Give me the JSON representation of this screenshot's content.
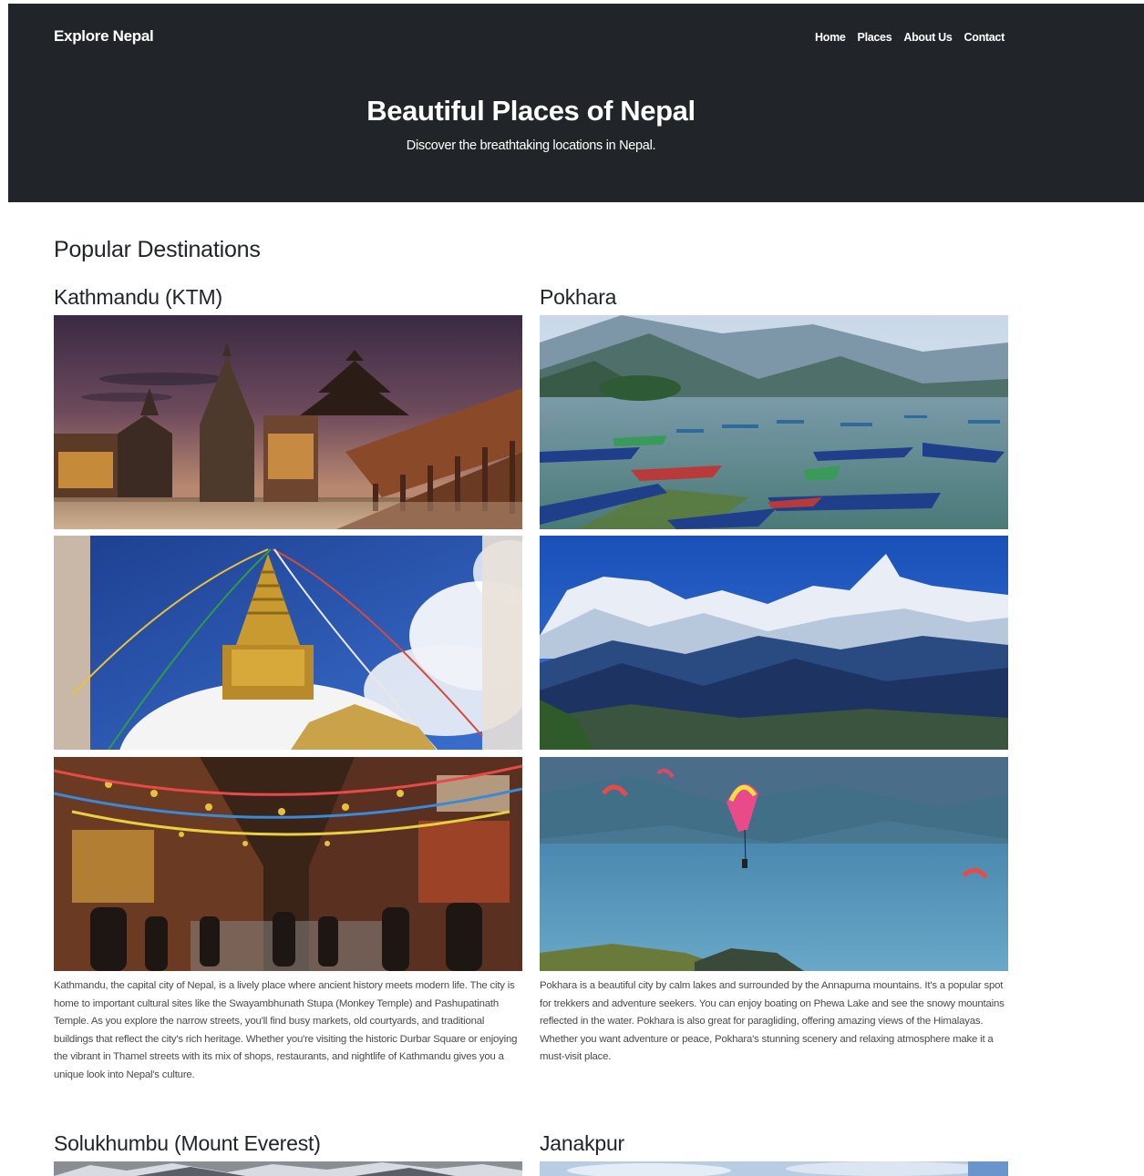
{
  "header": {
    "brand": "Explore Nepal",
    "nav": [
      "Home",
      "Places",
      "About Us",
      "Contact"
    ],
    "title": "Beautiful Places of Nepal",
    "subtitle": "Discover the breathtaking locations in Nepal."
  },
  "main": {
    "section_title": "Popular Destinations",
    "places": [
      {
        "name": "Kathmandu (KTM)",
        "description": "Kathmandu, the capital city of Nepal, is a lively place where ancient history meets modern life. The city is home to important cultural sites like the Swayambhunath Stupa (Monkey Temple) and Pashupatinath Temple. As you explore the narrow streets, you'll find busy markets, old courtyards, and traditional buildings that reflect the city's rich heritage. Whether you're visiting the historic Durbar Square or enjoying the vibrant in Thamel streets with its mix of shops, restaurants, and nightlife of Kathmandu gives you a unique look into Nepal's culture.",
        "photos": [
          "durbar-square-dusk",
          "swayambhunath-stupa",
          "thamel-street"
        ]
      },
      {
        "name": "Pokhara",
        "description": "Pokhara is a beautiful city by calm lakes and surrounded by the Annapurna mountains. It's a popular spot for trekkers and adventure seekers. You can enjoy boating on Phewa Lake and see the snowy mountains reflected in the water. Pokhara is also great for paragliding, offering amazing views of the Himalayas. Whether you want adventure or peace, Pokhara's stunning scenery and relaxing atmosphere make it a must-visit place.",
        "photos": [
          "phewa-lake-boats",
          "annapurna-range",
          "paragliding-lake"
        ]
      },
      {
        "name": "Solukhumbu (Mount Everest)",
        "photos": [
          "everest-snow-peaks"
        ]
      },
      {
        "name": "Janakpur",
        "photos": [
          "janakpur-sky"
        ]
      }
    ]
  },
  "colors": {
    "header_bg": "#212529",
    "header_text": "#ffffff",
    "heading_text": "#212529",
    "body_text": "#4a4a4a"
  }
}
